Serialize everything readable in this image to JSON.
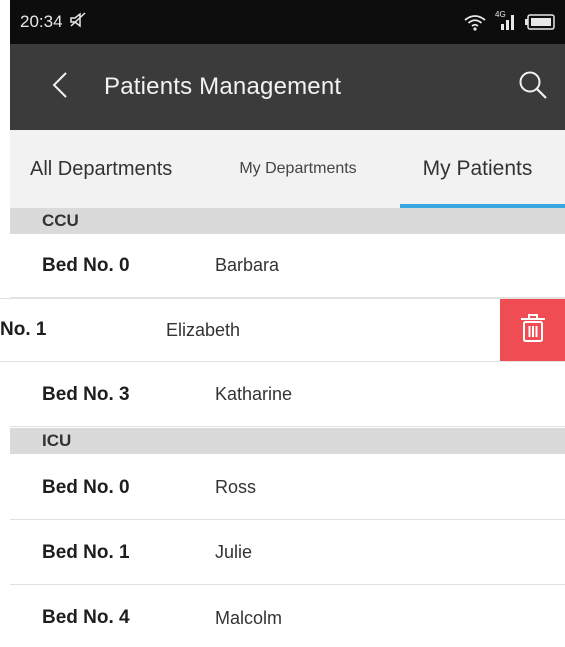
{
  "status_bar": {
    "time": "20:34",
    "network_label": "4G"
  },
  "header": {
    "title": "Patients Management"
  },
  "tabs": [
    {
      "label": "All Departments",
      "active": false
    },
    {
      "label": "My Departments",
      "active": false
    },
    {
      "label": "My Patients",
      "active": true
    }
  ],
  "departments": [
    {
      "name": "CCU",
      "patients": [
        {
          "bed": "Bed No. 0",
          "name": "Barbara"
        },
        {
          "bed": "No. 1",
          "name": "Elizabeth",
          "swiped": true
        },
        {
          "bed": "Bed No. 3",
          "name": "Katharine"
        }
      ]
    },
    {
      "name": "ICU",
      "patients": [
        {
          "bed": "Bed No. 0",
          "name": "Ross"
        },
        {
          "bed": "Bed No. 1",
          "name": "Julie"
        },
        {
          "bed": "Bed No. 4",
          "name": "Malcolm"
        }
      ]
    }
  ],
  "colors": {
    "status_bar_bg": "#0d0d0d",
    "app_bar_bg": "#3b3b3b",
    "tab_bar_bg": "#f2f2f2",
    "tab_indicator": "#3aa6e0",
    "section_header_bg": "#dadada",
    "delete_button_bg": "#f04c54"
  },
  "icons": {
    "silent": "mute-icon",
    "wifi": "wifi-icon",
    "signal": "signal-icon",
    "battery": "battery-icon",
    "back": "back-arrow-icon",
    "search": "search-icon",
    "delete": "trash-icon"
  }
}
